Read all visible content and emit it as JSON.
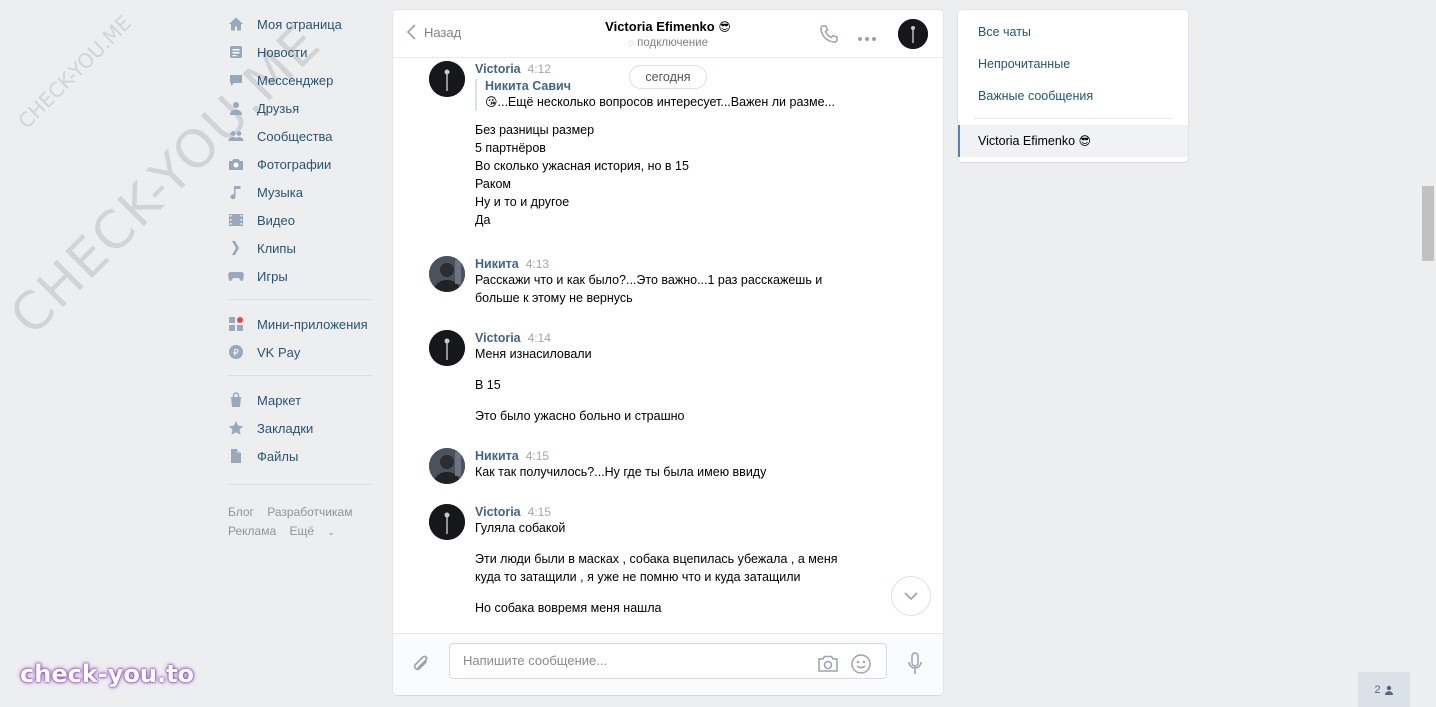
{
  "watermarks": {
    "diagonal": "CHECK-YOU.ME",
    "small": "CHECK-YOU.ME",
    "brand": "check-you.to"
  },
  "leftnav": {
    "items": [
      {
        "label": "Моя страница",
        "icon": "home-icon"
      },
      {
        "label": "Новости",
        "icon": "news-icon"
      },
      {
        "label": "Мессенджер",
        "icon": "messenger-icon"
      },
      {
        "label": "Друзья",
        "icon": "friends-icon"
      },
      {
        "label": "Сообщества",
        "icon": "communities-icon"
      },
      {
        "label": "Фотографии",
        "icon": "camera-icon"
      },
      {
        "label": "Музыка",
        "icon": "music-icon"
      },
      {
        "label": "Видео",
        "icon": "video-icon"
      },
      {
        "label": "Клипы",
        "icon": "clips-icon"
      },
      {
        "label": "Игры",
        "icon": "gamepad-icon"
      }
    ],
    "items2": [
      {
        "label": "Мини-приложения",
        "icon": "apps-icon"
      },
      {
        "label": "VK Pay",
        "icon": "vkpay-icon"
      }
    ],
    "items3": [
      {
        "label": "Маркет",
        "icon": "bag-icon"
      },
      {
        "label": "Закладки",
        "icon": "star-icon"
      },
      {
        "label": "Файлы",
        "icon": "file-icon"
      }
    ],
    "footer": {
      "blog": "Блог",
      "developers": "Разработчикам",
      "ads": "Реклама",
      "more": "Ещё"
    }
  },
  "chat": {
    "back_label": "Назад",
    "peer_name": "Victoria Efimenko",
    "peer_emoji": "😎",
    "status": "подключение",
    "date_pill": "сегодня",
    "messages": [
      {
        "author": "Victoria",
        "time": "4:12",
        "forward": {
          "author": "Никита Савич",
          "text": "...Ещё несколько вопросов интересует...Важен ли разме...",
          "emoji": "😘"
        },
        "lines": [
          "Без разницы размер",
          "5 партнёров",
          "Во сколько ужасная история, но в 15",
          "Раком",
          "Ну и то и другое",
          "Да"
        ]
      },
      {
        "author": "Никита",
        "time": "4:13",
        "lines": [
          "Расскажи что и как было?...Это важно...1 раз расскажешь и",
          "больше к этому не вернусь"
        ]
      },
      {
        "author": "Victoria",
        "time": "4:14",
        "lines": [
          "Меня изнасиловали",
          "В 15",
          "Это было ужасно больно и страшно"
        ]
      },
      {
        "author": "Никита",
        "time": "4:15",
        "lines": [
          "Как так получилось?...Ну где ты была имею ввиду"
        ]
      },
      {
        "author": "Victoria",
        "time": "4:15",
        "lines": [
          "Гуляла собакой",
          "Эти люди были в масках , собака вцепилась убежала , а меня",
          "куда то затащили , я уже не помню что и куда затащили",
          "Но собака вовремя меня нашла"
        ]
      }
    ],
    "composer_placeholder": "Напишите сообщение..."
  },
  "rpanel": {
    "all_chats": "Все чаты",
    "unread": "Непрочитанные",
    "important": "Важные сообщения",
    "active_chat": "Victoria Efimenko",
    "active_emoji": "😎"
  },
  "online_count": "2",
  "colors": {
    "link": "#285473",
    "author": "#42648b",
    "accent": "#5181b8",
    "bg": "#edeef0"
  }
}
